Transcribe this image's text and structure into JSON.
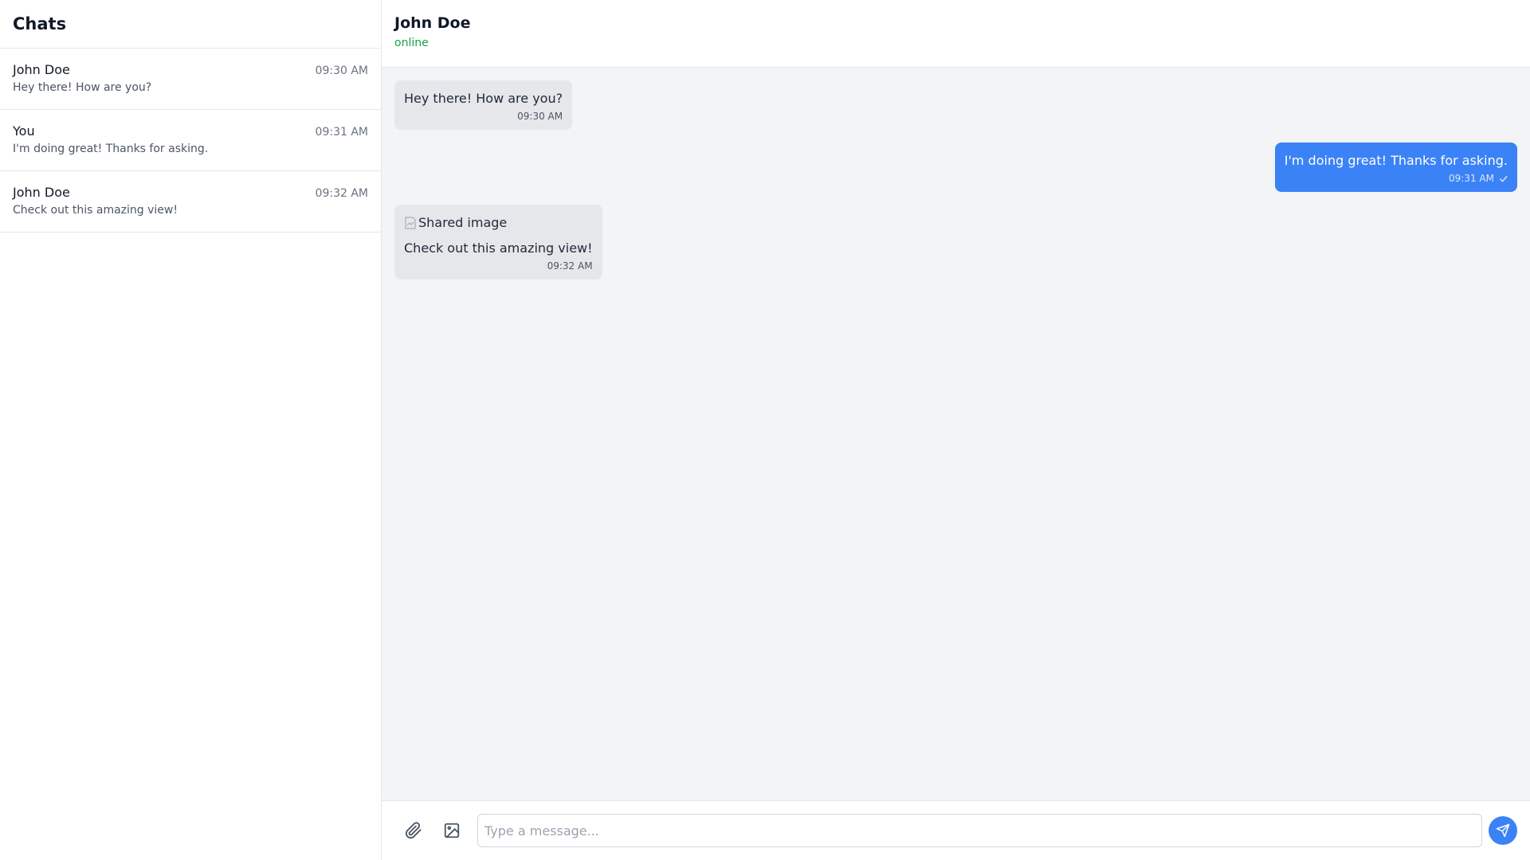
{
  "sidebar": {
    "title": "Chats",
    "items": [
      {
        "name": "John Doe",
        "time": "09:30 AM",
        "preview": "Hey there! How are you?"
      },
      {
        "name": "You",
        "time": "09:31 AM",
        "preview": "I'm doing great! Thanks for asking."
      },
      {
        "name": "John Doe",
        "time": "09:32 AM",
        "preview": "Check out this amazing view!"
      }
    ]
  },
  "header": {
    "name": "John Doe",
    "status": "online"
  },
  "messages": [
    {
      "direction": "in",
      "text": "Hey there! How are you?",
      "time": "09:30 AM"
    },
    {
      "direction": "out",
      "text": "I'm doing great! Thanks for asking.",
      "time": "09:31 AM",
      "status_icon": "check-icon"
    },
    {
      "direction": "in",
      "image_alt": "Shared image",
      "text": "Check out this amazing view!",
      "time": "09:32 AM"
    }
  ],
  "composer": {
    "placeholder": "Type a message...",
    "value": "",
    "attach_icon": "paperclip-icon",
    "image_icon": "image-icon",
    "send_icon": "send-icon"
  },
  "colors": {
    "accent": "#3b82f6",
    "online": "#16a34a",
    "incoming_bubble": "#e5e7eb",
    "background": "#f3f4f6"
  }
}
